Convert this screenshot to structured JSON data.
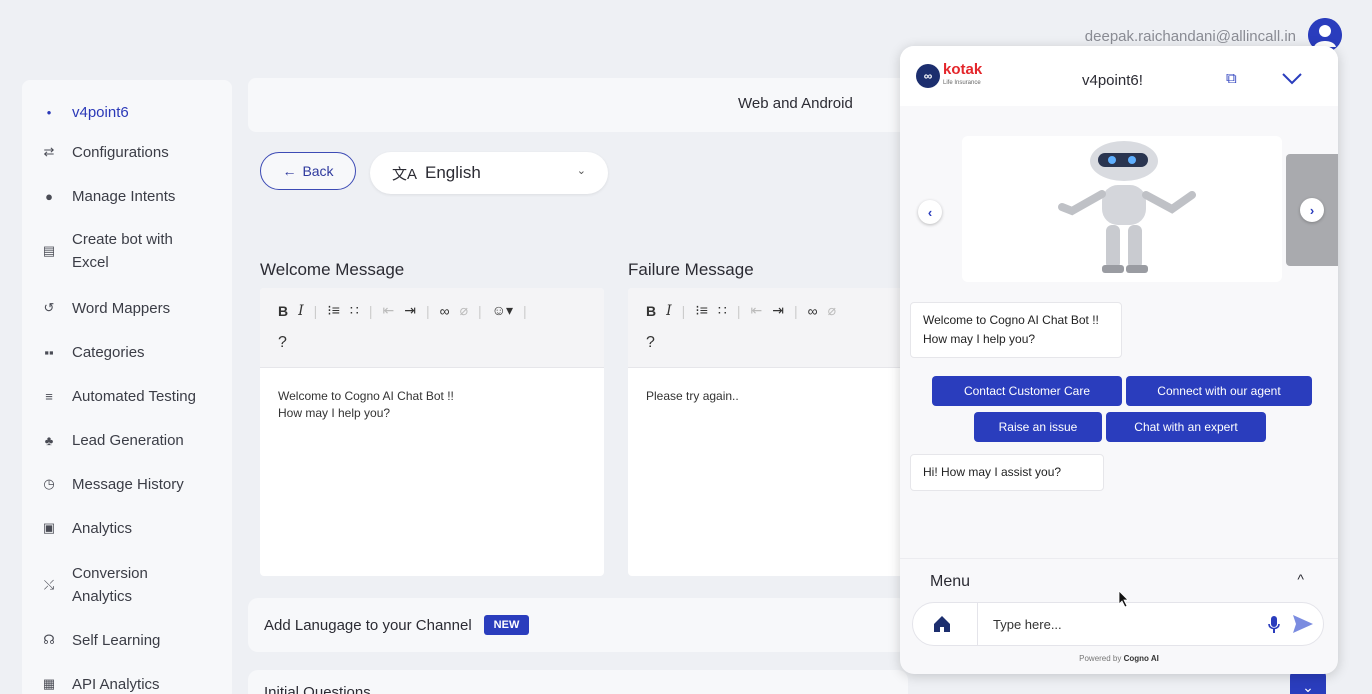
{
  "topbar": {
    "user_email": "deepak.raichandani@allincall.in"
  },
  "sidebar": {
    "items": [
      {
        "label": "v4point6",
        "icon": "dot-icon",
        "active": true
      },
      {
        "label": "Configurations",
        "icon": "sliders-icon"
      },
      {
        "label": "Manage Intents",
        "icon": "intents-icon"
      },
      {
        "label": "Create bot with Excel",
        "icon": "excel-icon"
      },
      {
        "label": "Word Mappers",
        "icon": "word-mapper-icon"
      },
      {
        "label": "Categories",
        "icon": "categories-icon"
      },
      {
        "label": "Automated Testing",
        "icon": "testing-icon"
      },
      {
        "label": "Lead Generation",
        "icon": "lead-icon"
      },
      {
        "label": "Message History",
        "icon": "history-icon"
      },
      {
        "label": "Analytics",
        "icon": "analytics-icon"
      },
      {
        "label": "Conversion Analytics",
        "icon": "conversion-icon"
      },
      {
        "label": "Self Learning",
        "icon": "self-learning-icon"
      },
      {
        "label": "API Analytics",
        "icon": "api-icon"
      }
    ]
  },
  "main": {
    "channel_tab": "Web and Android",
    "back_label": "Back",
    "language": "English",
    "welcome": {
      "title": "Welcome Message",
      "placeholder_symbol": "?",
      "line1": "Welcome to Cogno AI Chat Bot !!",
      "line2": "How may I help you?"
    },
    "failure": {
      "title": "Failure Message",
      "placeholder_symbol": "?",
      "text": "Please try again.."
    },
    "add_language": "Add Lanugage to your Channel",
    "new_badge": "NEW",
    "initial_questions": "Initial Questions"
  },
  "chat": {
    "brand": "kotak",
    "brand_sub": "Life Insurance",
    "title": "v4point6!",
    "welcome_line1": "Welcome to Cogno AI Chat Bot !!",
    "welcome_line2": "How may I help you?",
    "chips": [
      "Contact Customer Care",
      "Connect with our agent",
      "Raise an issue",
      "Chat with an expert"
    ],
    "reply": "Hi! How may I assist you?",
    "menu_label": "Menu",
    "input_placeholder": "Type here...",
    "powered_prefix": "Powered by",
    "powered_brand": "Cogno AI"
  },
  "colors": {
    "accent": "#2a3dbd",
    "brand_red": "#e4262b",
    "navy": "#1c2e6e"
  }
}
